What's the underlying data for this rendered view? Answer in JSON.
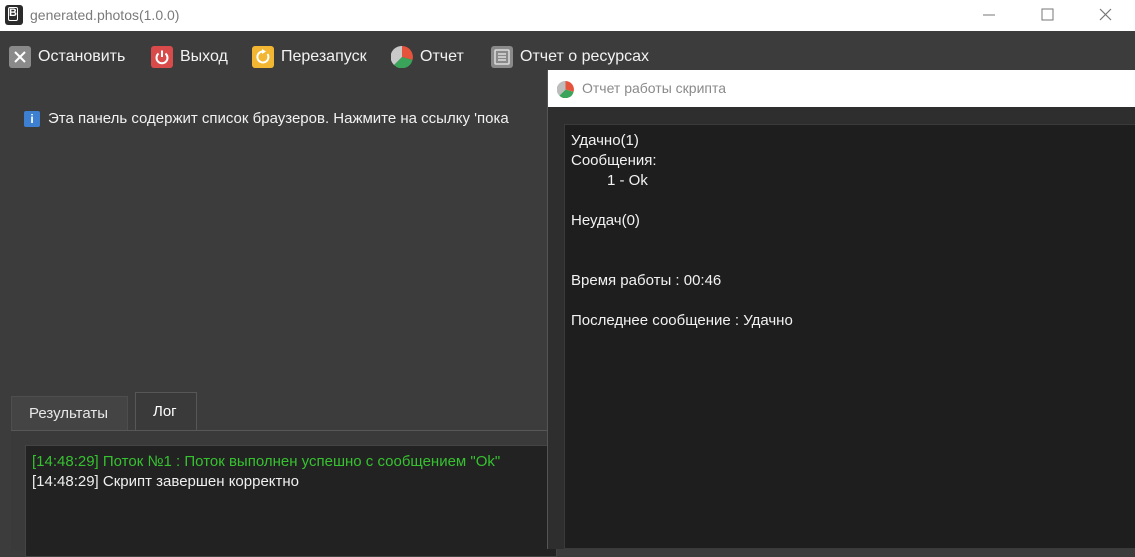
{
  "window": {
    "title": "generated.photos(1.0.0)",
    "app_icon_letter": "B"
  },
  "toolbar": {
    "items": [
      {
        "label": "Остановить",
        "icon": "stop-icon"
      },
      {
        "label": "Выход",
        "icon": "power-icon"
      },
      {
        "label": "Перезапуск",
        "icon": "restart-icon"
      },
      {
        "label": "Отчет",
        "icon": "pie-chart-icon"
      },
      {
        "label": "Отчет о ресурсах",
        "icon": "resources-icon"
      }
    ]
  },
  "info": {
    "icon": "info-icon",
    "text": "Эта панель содержит список браузеров. Нажмите на ссылку 'пока"
  },
  "tabs": {
    "items": [
      {
        "label": "Результаты",
        "active": false
      },
      {
        "label": "Лог",
        "active": true
      }
    ]
  },
  "log": {
    "lines": [
      {
        "text": "[14:48:29] Поток №1 : Поток выполнен успешно с сообщением \"Ok\"",
        "color": "#36c230"
      },
      {
        "text": "[14:48:29] Скрипт завершен корректно",
        "color": "#f0f0f0"
      }
    ]
  },
  "report_dialog": {
    "title": "Отчет работы скрипта",
    "lines": [
      "Удачно(1)",
      "Сообщения:",
      "1 - Ok",
      "Неудач(0)",
      "Время работы : 00:46",
      "Последнее сообщение : Удачно"
    ]
  },
  "colors": {
    "background": "#3c3c3c",
    "log_success": "#36c230",
    "stop_button": "#8a8a8a",
    "exit_button": "#d94b4b",
    "restart_button": "#f2b632"
  }
}
